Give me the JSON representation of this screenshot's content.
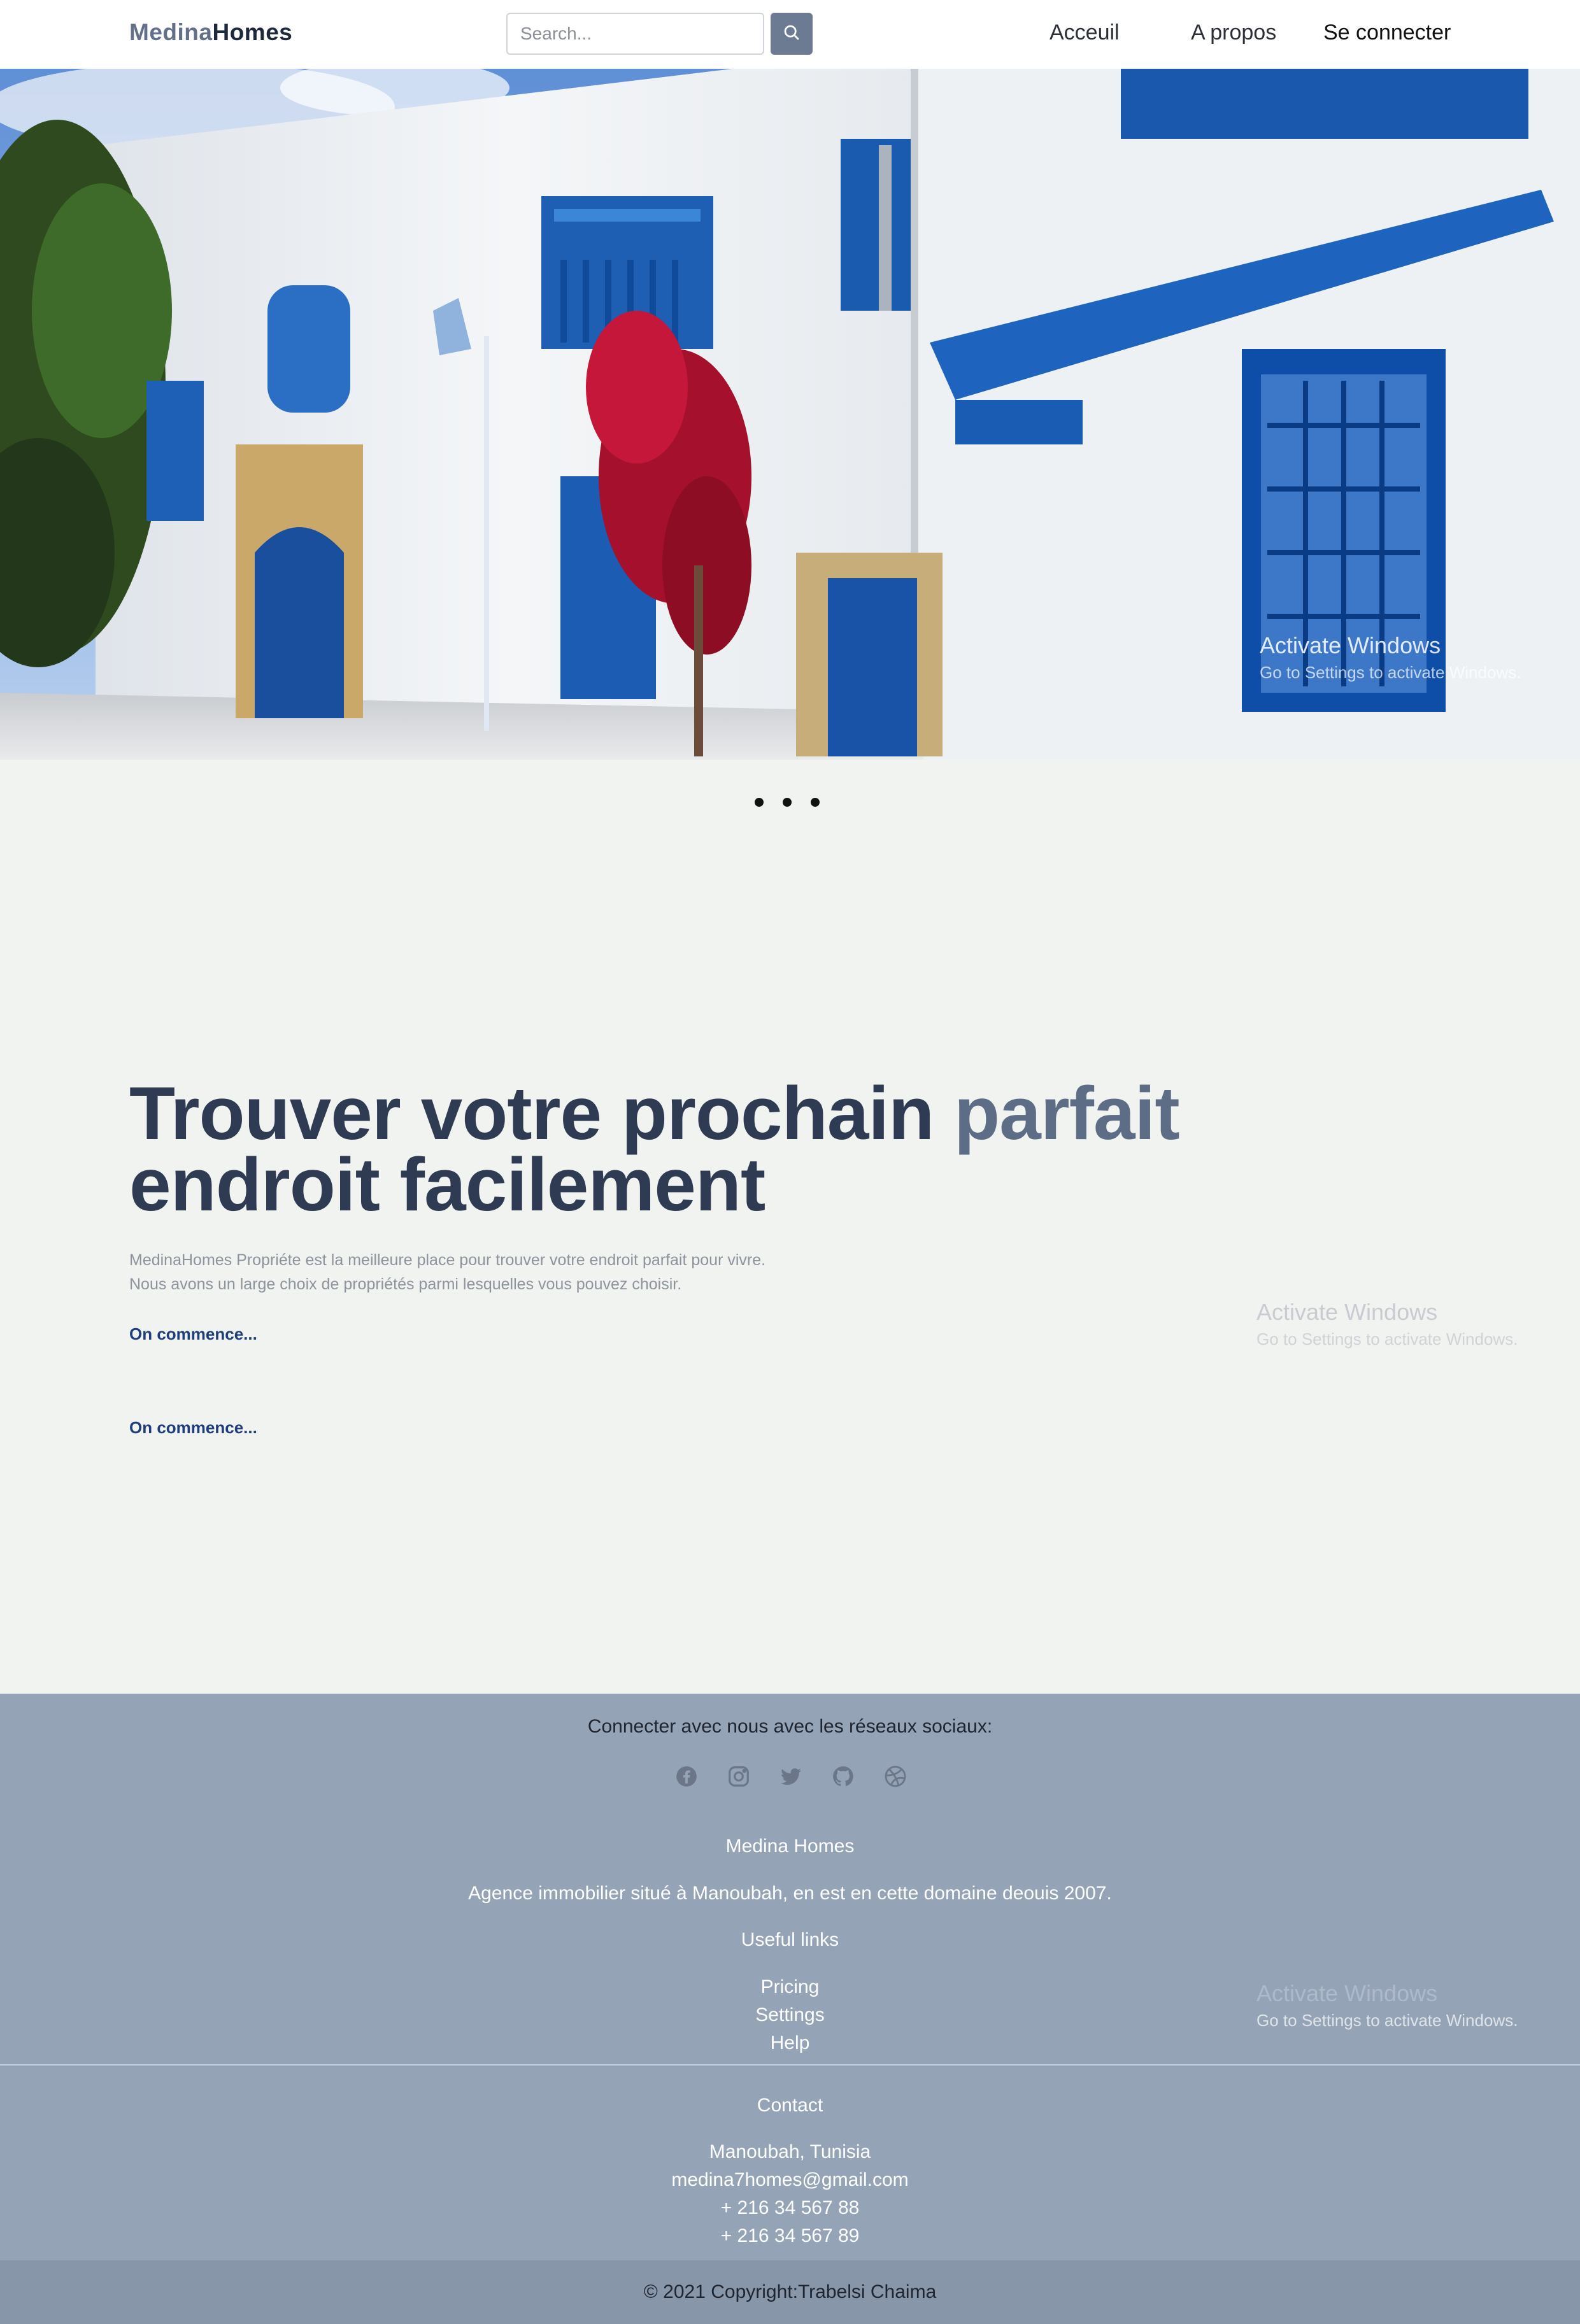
{
  "header": {
    "brand_part1": "Medina",
    "brand_part2": "Homes",
    "search_placeholder": "Search...",
    "nav": [
      {
        "label": "Acceuil"
      },
      {
        "label": "A propos"
      },
      {
        "label": "Se connecter"
      }
    ],
    "icons": {
      "search": "search-icon"
    }
  },
  "hero": {
    "carousel_slides": 3,
    "watermark_title": "Activate Windows",
    "watermark_sub": "Go to Settings to activate Windows."
  },
  "main": {
    "headline_part1": "Trouver votre prochain ",
    "headline_accent": "parfait",
    "headline_part2": "endroit facilement",
    "intro_line1": "MedinaHomes Propriéte est la meilleure place pour trouver votre endroit parfait pour vivre.",
    "intro_line2": "Nous avons un large choix de propriétés parmi lesquelles vous pouvez choisir.",
    "cta1": "On commence...",
    "cta2": "On commence...",
    "watermark_title": "Activate Windows",
    "watermark_sub": "Go to Settings to activate Windows."
  },
  "footer": {
    "social_heading": "Connecter avec nous avec les réseaux sociaux:",
    "social_icons": [
      "facebook-icon",
      "instagram-icon",
      "twitter-icon",
      "github-icon",
      "dribbble-icon"
    ],
    "company_name": "Medina Homes",
    "company_desc": "Agence immobilier situé à Manoubah, en est en cette domaine deouis 2007.",
    "useful_links_heading": "Useful links",
    "links": [
      "Pricing",
      "Settings",
      "Help"
    ],
    "contact_heading": "Contact",
    "contact": [
      "Manoubah, Tunisia",
      "medina7homes@gmail.com",
      "+ 216 34 567 88",
      "+ 216 34 567 89"
    ],
    "copyright": "© 2021 Copyright:Trabelsi Chaima",
    "watermark_title": "Activate Windows",
    "watermark_sub": "Go to Settings to activate Windows."
  },
  "colors": {
    "accent": "#5d6d86",
    "heading": "#2f3b52",
    "footer_bg": "#94a3b6",
    "link_blue": "#1f3d7a"
  }
}
